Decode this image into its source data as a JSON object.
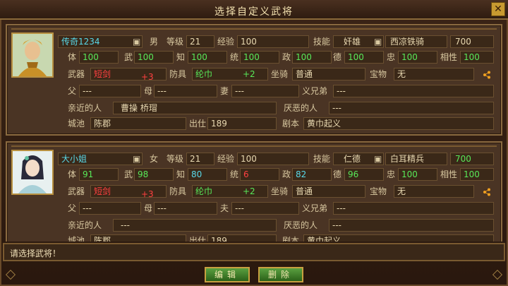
{
  "window": {
    "title": "选择自定义武将",
    "close_label": "✕"
  },
  "cards": [
    {
      "name": "传奇1234",
      "gender": "男",
      "level_label": "等级",
      "level": "21",
      "exp_label": "经验",
      "exp": "100",
      "skill_label": "技能",
      "skill": "奸雄",
      "troop": "西凉铁骑",
      "troop_val": "700",
      "stats": [
        {
          "label": "体",
          "value": "100",
          "color": "green"
        },
        {
          "label": "武",
          "value": "100",
          "color": "green"
        },
        {
          "label": "知",
          "value": "100",
          "color": "green"
        },
        {
          "label": "统",
          "value": "100",
          "color": "green"
        },
        {
          "label": "政",
          "value": "100",
          "color": "green"
        },
        {
          "label": "德",
          "value": "100",
          "color": "green"
        },
        {
          "label": "忠",
          "value": "100",
          "color": "green"
        },
        {
          "label": "相性",
          "value": "100",
          "color": "green"
        }
      ],
      "weapon_label": "武器",
      "weapon": "短剑",
      "weapon_bonus": "+3",
      "armor_label": "防具",
      "armor": "纶巾",
      "armor_bonus": "+2",
      "mount_label": "坐骑",
      "mount": "普通",
      "treasure_label": "宝物",
      "treasure": "无",
      "father_label": "父",
      "father": "---",
      "mother_label": "母",
      "mother": "---",
      "spouse_label": "妻",
      "spouse": "---",
      "sworn_label": "义兄弟",
      "sworn": "---",
      "close_label": "亲近的人",
      "close": "曹操 桥瑁",
      "hate_label": "厌恶的人",
      "hate": "---",
      "city_label": "城池",
      "city": "陈郡",
      "debut_label": "出仕",
      "debut": "189",
      "script_label": "剧本",
      "script": "黄巾起义"
    },
    {
      "name": "大小姐",
      "gender": "女",
      "level_label": "等级",
      "level": "21",
      "exp_label": "经验",
      "exp": "100",
      "skill_label": "技能",
      "skill": "仁德",
      "troop": "白耳精兵",
      "troop_val": "700",
      "stats": [
        {
          "label": "体",
          "value": "91",
          "color": "green"
        },
        {
          "label": "武",
          "value": "98",
          "color": "green"
        },
        {
          "label": "知",
          "value": "80",
          "color": "cyan"
        },
        {
          "label": "统",
          "value": "6",
          "color": "red"
        },
        {
          "label": "政",
          "value": "82",
          "color": "cyan"
        },
        {
          "label": "德",
          "value": "96",
          "color": "green"
        },
        {
          "label": "忠",
          "value": "100",
          "color": "green"
        },
        {
          "label": "相性",
          "value": "100",
          "color": "green"
        }
      ],
      "weapon_label": "武器",
      "weapon": "短剑",
      "weapon_bonus": "+3",
      "armor_label": "防具",
      "armor": "纶巾",
      "armor_bonus": "+2",
      "mount_label": "坐骑",
      "mount": "普通",
      "treasure_label": "宝物",
      "treasure": "无",
      "father_label": "父",
      "father": "---",
      "mother_label": "母",
      "mother": "---",
      "spouse_label": "夫",
      "spouse": "---",
      "sworn_label": "义兄弟",
      "sworn": "---",
      "close_label": "亲近的人",
      "close": "---",
      "hate_label": "厌恶的人",
      "hate": "---",
      "city_label": "城池",
      "city": "陈郡",
      "debut_label": "出仕",
      "debut": "189",
      "script_label": "剧本",
      "script": "黄巾起义"
    }
  ],
  "message": "请选择武将！",
  "buttons": {
    "edit": "编辑",
    "delete": "删除"
  }
}
